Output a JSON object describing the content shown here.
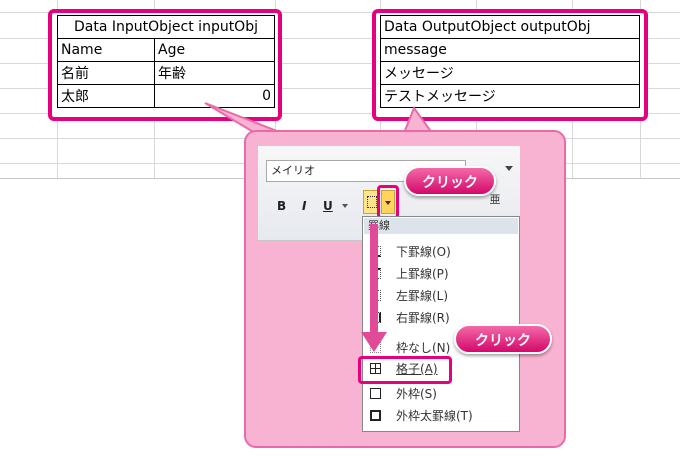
{
  "input_table": {
    "header": "Data InputObject inputObj",
    "rows": [
      [
        "Name",
        "Age"
      ],
      [
        "名前",
        "年齢"
      ],
      [
        "太郎",
        "0"
      ]
    ]
  },
  "output_table": {
    "header": "Data OutputObject outputObj",
    "rows": [
      "message",
      "メッセージ",
      "テストメッセージ"
    ]
  },
  "ribbon": {
    "font_name": "メイリオ",
    "bold": "B",
    "italic": "I",
    "underline": "U"
  },
  "callouts": {
    "click_top": "クリック",
    "click_menu": "クリック"
  },
  "border_menu": {
    "title": "罫線",
    "items": [
      {
        "label": "下罫線(O)",
        "icon": "border-bottom-icon"
      },
      {
        "label": "上罫線(P)",
        "icon": "border-top-icon"
      },
      {
        "label": "左罫線(L)",
        "icon": "border-left-icon"
      },
      {
        "label": "右罫線(R)",
        "icon": "border-right-icon"
      },
      {
        "label": "枠なし(N)",
        "icon": "no-border-icon"
      },
      {
        "label": "格子(A)",
        "icon": "all-borders-icon",
        "highlighted": true
      },
      {
        "label": "外枠(S)",
        "icon": "outside-borders-icon"
      },
      {
        "label": "外枠太罫線(T)",
        "icon": "thick-box-border-icon"
      }
    ]
  },
  "colors": {
    "accent": "#e6007e",
    "callout_bg": "#f8b3d2",
    "button_gradient": "#d4086b"
  }
}
